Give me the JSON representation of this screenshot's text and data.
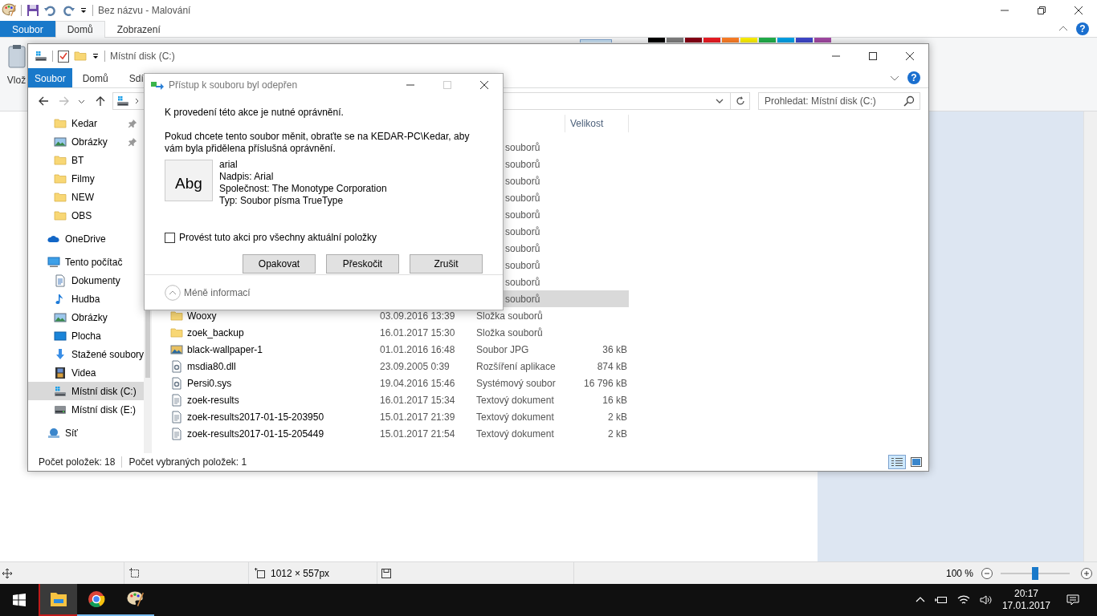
{
  "paint": {
    "title": "Bez názvu - Malování",
    "tabs": [
      {
        "label": "Soubor",
        "kind": "file",
        "selected": false
      },
      {
        "label": "Domů",
        "kind": "tab",
        "selected": true
      },
      {
        "label": "Zobrazení",
        "kind": "tab",
        "selected": false
      }
    ],
    "help": "?",
    "paste_label": "Vlož",
    "palette": [
      {
        "color": "#000000"
      },
      {
        "color": "#7f7f7f"
      },
      {
        "color": "#880015"
      },
      {
        "color": "#ed1c24"
      },
      {
        "color": "#ff7f27"
      },
      {
        "color": "#fff200"
      },
      {
        "color": "#22b14c"
      },
      {
        "color": "#00a2e8"
      },
      {
        "color": "#3f48cc"
      },
      {
        "color": "#a349a4"
      }
    ],
    "status": {
      "canvas_size": "1012 × 557px",
      "zoom": {
        "reading": "100 %",
        "level": 0.5
      }
    }
  },
  "explorer": {
    "title": "Místní disk (C:)",
    "tabs": [
      {
        "label": "Soubor",
        "kind": "file",
        "selected": false
      },
      {
        "label": "Domů",
        "kind": "tab",
        "selected": false
      },
      {
        "label": "Sdí",
        "kind": "tab",
        "selected": false
      }
    ],
    "help": "?",
    "search": {
      "placeholder": "Prohledat: Místní disk (C:)"
    },
    "nav": {
      "quick_items": [
        {
          "label": "Kedar",
          "kind": "folder",
          "pinned": true,
          "selected": false
        },
        {
          "label": "Obrázky",
          "kind": "pictures",
          "pinned": true,
          "selected": false
        },
        {
          "label": "BT",
          "kind": "folder",
          "pinned": false,
          "selected": false
        },
        {
          "label": "Filmy",
          "kind": "folder",
          "pinned": false,
          "selected": false
        },
        {
          "label": "NEW",
          "kind": "folder",
          "pinned": false,
          "selected": false
        },
        {
          "label": "OBS",
          "kind": "folder",
          "pinned": false,
          "selected": false
        }
      ],
      "tree": [
        {
          "label": "OneDrive",
          "kind": "cloud",
          "selected": false
        },
        {
          "label": "Tento počítač",
          "kind": "pc",
          "selected": false,
          "children": [
            {
              "label": "Dokumenty",
              "kind": "docs",
              "selected": false
            },
            {
              "label": "Hudba",
              "kind": "music",
              "selected": false
            },
            {
              "label": "Obrázky",
              "kind": "pictures",
              "selected": false
            },
            {
              "label": "Plocha",
              "kind": "desktop",
              "selected": false
            },
            {
              "label": "Stažené soubory",
              "kind": "downloads",
              "selected": false
            },
            {
              "label": "Videa",
              "kind": "videos",
              "selected": false
            },
            {
              "label": "Místní disk (C:)",
              "kind": "drivewin",
              "selected": true
            },
            {
              "label": "Místní disk (E:)",
              "kind": "drive",
              "selected": false
            }
          ]
        },
        {
          "label": "Síť",
          "kind": "network",
          "selected": false
        }
      ]
    },
    "size_header": "Velikost",
    "files": [
      {
        "type": "souborů",
        "selected": false
      },
      {
        "type": "souborů",
        "selected": false
      },
      {
        "type": "souborů",
        "selected": false
      },
      {
        "type": "souborů",
        "selected": false
      },
      {
        "type": "souborů",
        "selected": false
      },
      {
        "type": "souborů",
        "selected": false
      },
      {
        "type": "souborů",
        "selected": false
      },
      {
        "type": "souborů",
        "selected": false
      },
      {
        "type": "souborů",
        "selected": false
      },
      {
        "type": "souborů",
        "selected": true
      },
      {
        "name": "Wooxy",
        "kind": "folder",
        "date": "03.09.2016 13:39",
        "type": "Složka souborů",
        "selected": false
      },
      {
        "name": "zoek_backup",
        "kind": "folder",
        "date": "16.01.2017 15:30",
        "type": "Složka souborů",
        "selected": false
      },
      {
        "name": "black-wallpaper-1",
        "kind": "imagefile",
        "date": "01.01.2016 16:48",
        "type": "Soubor JPG",
        "size": "36 kB",
        "selected": false
      },
      {
        "name": "msdia80.dll",
        "kind": "sysfile",
        "date": "23.09.2005 0:39",
        "type": "Rozšíření aplikace",
        "size": "874 kB",
        "selected": false
      },
      {
        "name": "Persi0.sys",
        "kind": "sysfile",
        "date": "19.04.2016 15:46",
        "type": "Systémový soubor",
        "size": "16 796 kB",
        "selected": false
      },
      {
        "name": "zoek-results",
        "kind": "textfile",
        "date": "16.01.2017 15:34",
        "type": "Textový dokument",
        "size": "16 kB",
        "selected": false
      },
      {
        "name": "zoek-results2017-01-15-203950",
        "kind": "textfile",
        "date": "15.01.2017 21:39",
        "type": "Textový dokument",
        "size": "2 kB",
        "selected": false
      },
      {
        "name": "zoek-results2017-01-15-205449",
        "kind": "textfile",
        "date": "15.01.2017 21:54",
        "type": "Textový dokument",
        "size": "2 kB",
        "selected": false
      }
    ],
    "status": {
      "item_count": "Počet položek: 18",
      "selected_count": "Počet vybraných položek: 1"
    },
    "views": [
      {
        "kind": "details",
        "selected": true
      },
      {
        "kind": "tiles",
        "selected": false
      }
    ]
  },
  "dialog": {
    "title": "Přístup k souboru byl odepřen",
    "message": "K provedení této akce je nutné oprávnění.",
    "detail": "Pokud chcete tento soubor měnit, obraťte se na KEDAR-PC\\Kedar, aby vám byla přidělena příslušná oprávnění.",
    "file": {
      "preview": "Abg",
      "lines": [
        "arial",
        "Nadpis: Arial",
        "Společnost: The Monotype Corporation",
        "Typ: Soubor písma TrueType"
      ]
    },
    "checkbox": {
      "label": "Provést tuto akci pro všechny aktuální položky",
      "checked": false
    },
    "buttons": [
      "Opakovat",
      "Přeskočit",
      "Zrušit"
    ],
    "footer": "Méně informací"
  },
  "taskbar": {
    "apps": [
      {
        "kind": "explorer",
        "active": true
      },
      {
        "kind": "browser",
        "active": false
      },
      {
        "kind": "paint",
        "active": false
      }
    ],
    "time": "20:17",
    "date": "17.01.2017"
  }
}
